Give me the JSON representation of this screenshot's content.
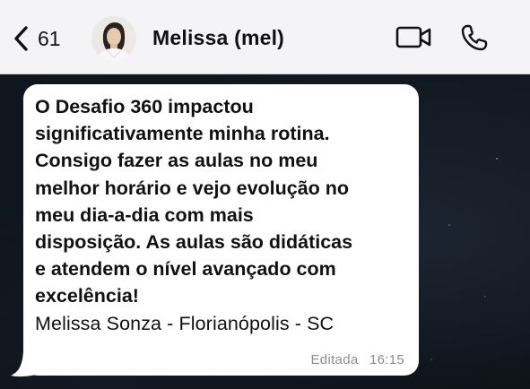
{
  "header": {
    "back_count": "61",
    "contact_name": "Melissa (mel)",
    "icons": {
      "back": "chevron-left-icon",
      "video": "video-camera-icon",
      "call": "phone-icon"
    }
  },
  "message": {
    "bold_lines": [
      "O Desafio 360 impactou",
      "significativamente minha rotina.",
      "Consigo fazer as aulas no meu",
      "melhor horário e vejo evolução no",
      "meu dia-a-dia com mais",
      "disposição. As aulas são didáticas",
      "e atendem o nível avançado com",
      "excelência!"
    ],
    "signature": "Melissa Sonza - Florianópolis - SC",
    "edited_label": "Editada",
    "time": "16:15"
  },
  "colors": {
    "header_bg": "#f4f4f6",
    "bubble_bg": "#ffffff",
    "chat_bg": "#0d1118",
    "meta_text": "#8c8c92"
  }
}
